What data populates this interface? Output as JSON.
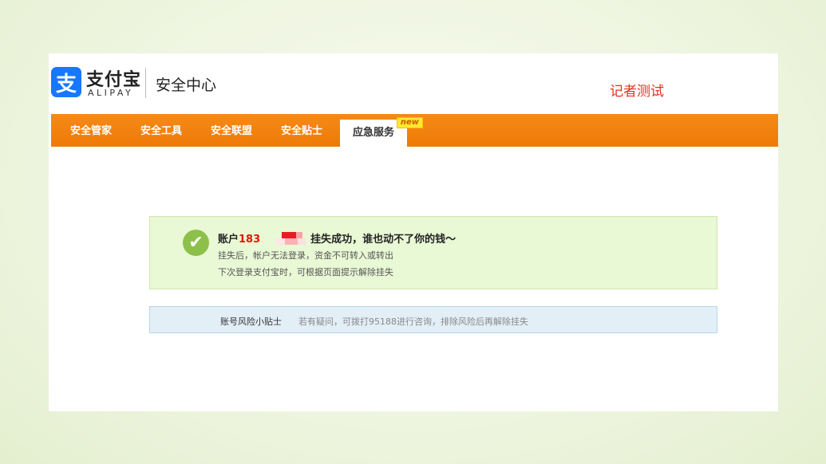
{
  "header": {
    "logo_glyph": "支",
    "logo_cn": "支付宝",
    "logo_en": "ALIPAY",
    "site_title": "安全中心",
    "reporter_text": "记者测试"
  },
  "nav": {
    "items": [
      {
        "label": "安全管家"
      },
      {
        "label": "安全工具"
      },
      {
        "label": "安全联盟"
      },
      {
        "label": "安全贴士"
      },
      {
        "label": "应急服务",
        "badge": "new",
        "active": true
      }
    ]
  },
  "success": {
    "title_prefix": "账户",
    "account_number": "183",
    "title_suffix": "挂失成功，谁也动不了你的钱～",
    "line1": "挂失后，帐户无法登录，资金不可转入或转出",
    "line2": "下次登录支付宝时，可根据页面提示解除挂失"
  },
  "tips": {
    "label": "账号风险小贴士",
    "text": "若有疑问，可拨打95188进行咨询，排除风险后再解除挂失"
  },
  "colors": {
    "nav_orange": "#f08008",
    "alipay_blue": "#1677ff",
    "success_green": "#8dc04a",
    "reporter_red": "#e8301c"
  }
}
